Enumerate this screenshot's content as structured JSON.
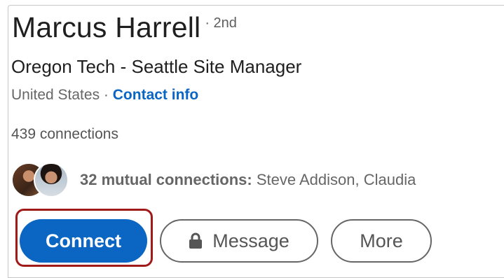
{
  "profile": {
    "name": "Marcus Harrell",
    "degree": "· 2nd",
    "headline": "Oregon Tech - Seattle Site Manager",
    "location": "United States",
    "location_separator": " · ",
    "contact_info_label": "Contact info",
    "connections": "439 connections",
    "mutual_bold": "32 mutual connections:",
    "mutual_names": " Steve Addison, Claudia"
  },
  "actions": {
    "connect_label": "Connect",
    "message_label": "Message",
    "more_label": "More"
  },
  "icons": {
    "lock": "lock-icon"
  },
  "colors": {
    "primary": "#0a66c2",
    "highlight": "#a11a1a",
    "text": "#1f1f1f",
    "muted": "#666666"
  }
}
